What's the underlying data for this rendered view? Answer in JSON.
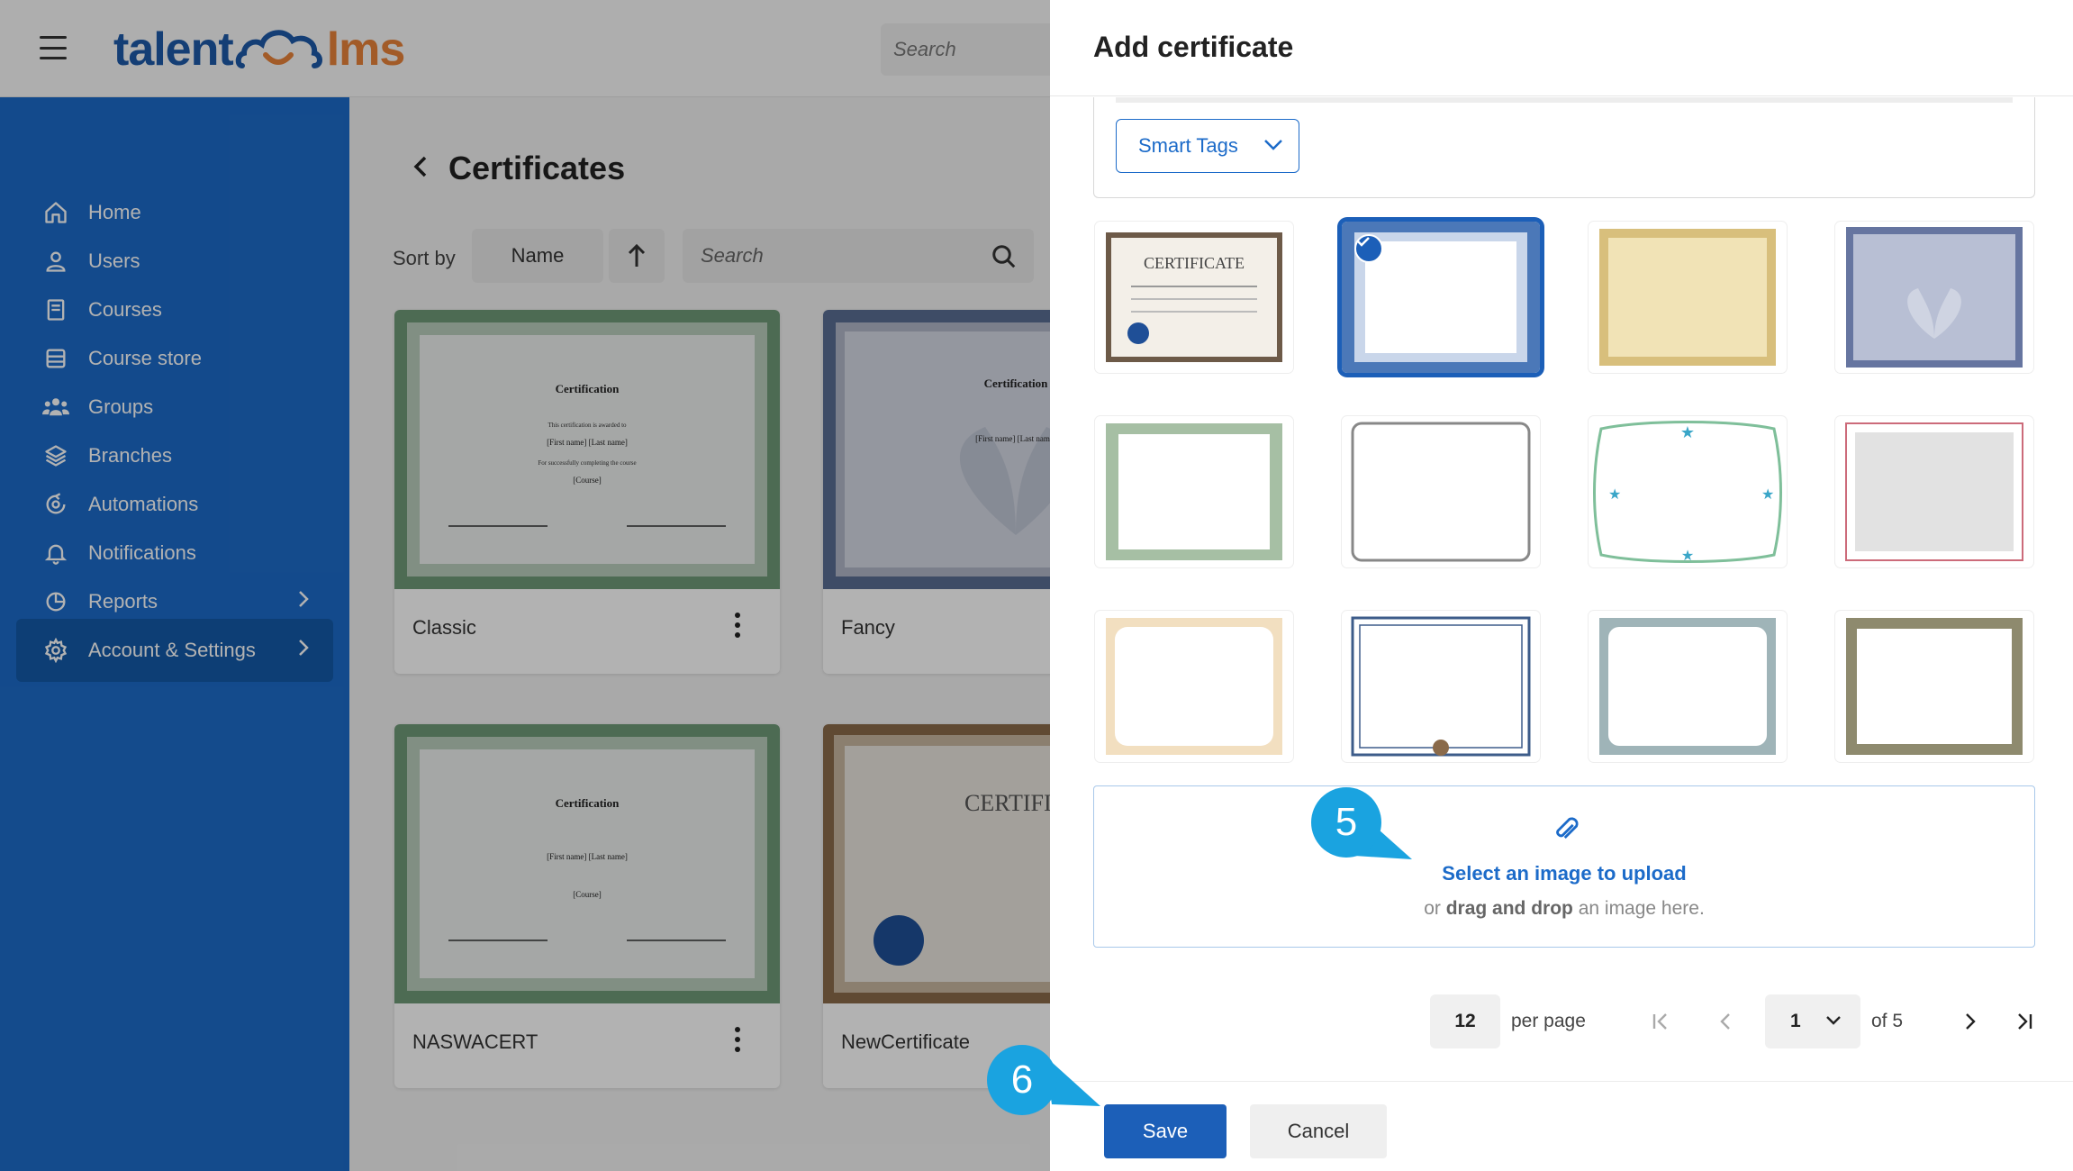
{
  "app": {
    "logo_left": "talent",
    "logo_right": "lms",
    "top_search_placeholder": "Search"
  },
  "sidebar": {
    "items": [
      {
        "label": "Home",
        "icon": "home-icon"
      },
      {
        "label": "Users",
        "icon": "user-icon"
      },
      {
        "label": "Courses",
        "icon": "book-icon"
      },
      {
        "label": "Course store",
        "icon": "store-icon"
      },
      {
        "label": "Groups",
        "icon": "groups-icon"
      },
      {
        "label": "Branches",
        "icon": "branches-icon"
      },
      {
        "label": "Automations",
        "icon": "automations-icon"
      },
      {
        "label": "Notifications",
        "icon": "bell-icon"
      },
      {
        "label": "Reports",
        "icon": "reports-icon"
      },
      {
        "label": "Account & Settings",
        "icon": "gear-icon"
      }
    ],
    "active": "Account & Settings"
  },
  "main": {
    "title": "Certificates",
    "sort_label": "Sort by",
    "sort_value": "Name",
    "search_placeholder": "Search",
    "cards": [
      {
        "name": "Classic"
      },
      {
        "name": "Fancy"
      },
      {
        "name": "NASWACERT"
      },
      {
        "name": "NewCertificate"
      }
    ]
  },
  "drawer": {
    "title": "Add certificate",
    "smart_tags_label": "Smart Tags",
    "templates_selected_index": 1,
    "upload": {
      "title": "Select an image to upload",
      "sub_prefix": "or ",
      "sub_bold": "drag and drop",
      "sub_suffix": " an image here."
    },
    "pagination": {
      "per_page_value": "12",
      "per_page_label": "per page",
      "current_page": "1",
      "of_label": "of 5"
    },
    "save_label": "Save",
    "cancel_label": "Cancel"
  },
  "steps": {
    "upload_step": "5",
    "save_step": "6"
  },
  "colors": {
    "brand_blue": "#1c6bc9",
    "brand_orange": "#e8833a",
    "step_marker": "#1aa3e0"
  }
}
